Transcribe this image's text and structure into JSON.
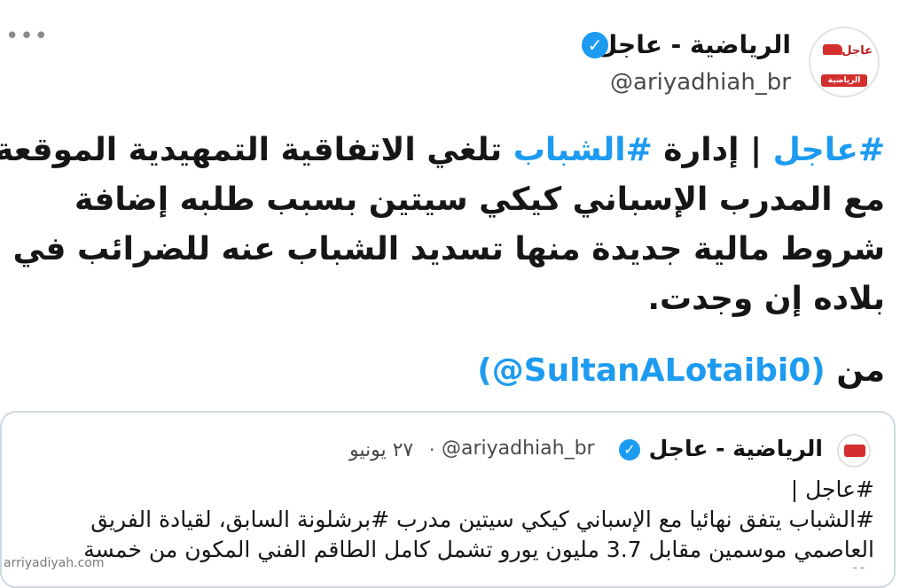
{
  "colors": {
    "accent": "#1d9bf0",
    "brand_red": "#d32f2f",
    "text": "#161616",
    "muted": "#4a4a4a"
  },
  "header": {
    "more_icon": "more-dots-icon",
    "avatar_brand_top": "عاجل",
    "avatar_brand_bottom": "الرياضية",
    "account_name": "الرياضية - عاجل",
    "handle": "@ariyadhiah_br"
  },
  "tweet": {
    "line1_hash": "#عاجل",
    "line1_sep": " | إدارة ",
    "line1_hash2": "#الشباب",
    "line1_rest": " تلغي الاتفاقية التمهيدية الموقعة",
    "line2": "مع المدرب الإسباني كيكي سيتين بسبب طلبه إضافة",
    "line3": "شروط مالية جديدة منها تسديد الشباب عنه للضرائب في",
    "line4": "بلاده إن وجدت.",
    "from_label": "من",
    "mention": "(@SultanALotaibi0)"
  },
  "quote": {
    "account_name": "الرياضية - عاجل",
    "handle": "@ariyadhiah_br",
    "dot": "·",
    "date": "٢٧ يونيو",
    "line1": "#عاجل |",
    "line2": "#الشباب يتفق نهائيا مع الإسباني كيكي سيتين مدرب #برشلونة السابق، لقيادة الفريق",
    "line3": "العاصمي موسمين مقابل 3.7 مليون يورو تشمل كامل الطاقم الفني المكون من خمسة"
  },
  "watermark": "arriyadiyah.com"
}
